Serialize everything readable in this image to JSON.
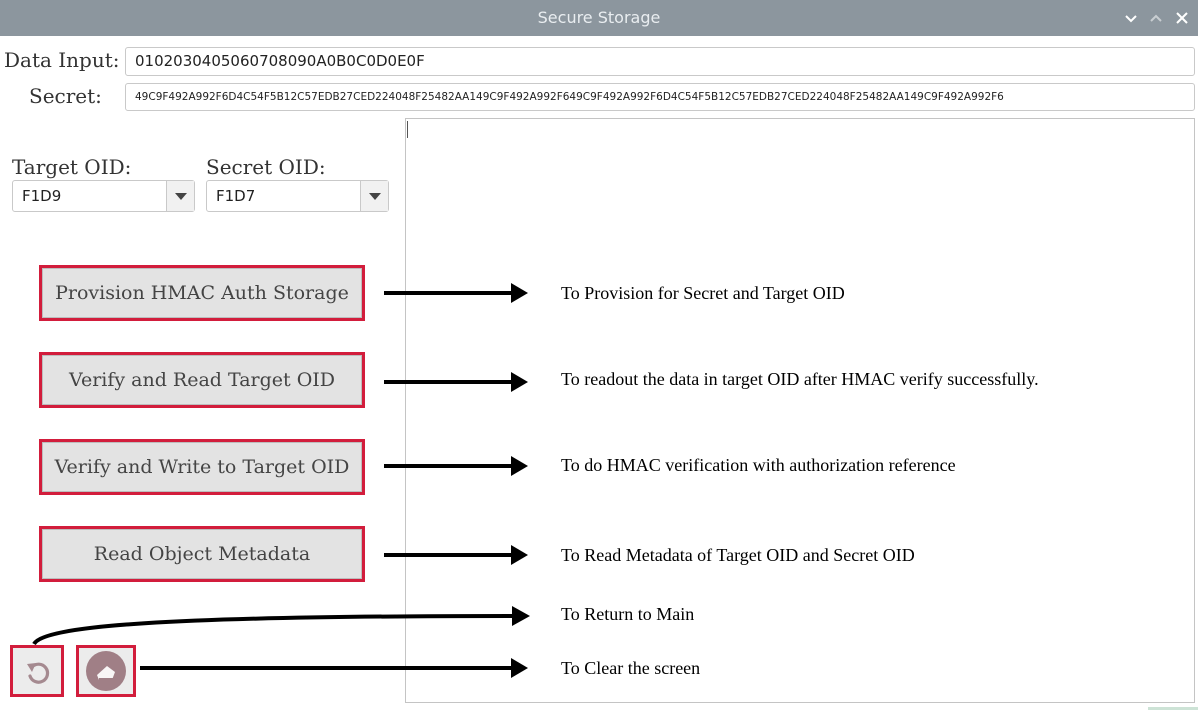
{
  "window": {
    "title": "Secure Storage",
    "controls": [
      "chevron-down-icon",
      "chevron-up-icon",
      "close-icon"
    ]
  },
  "inputs": {
    "data_label": "Data Input:",
    "data_value": "0102030405060708090A0B0C0D0E0F",
    "secret_label": "Secret:",
    "secret_value": "49C9F492A992F6D4C54F5B12C57EDB27CED224048F25482AA149C9F492A992F649C9F492A992F6D4C54F5B12C57EDB27CED224048F25482AA149C9F492A992F6"
  },
  "selectors": {
    "target_label": "Target OID:",
    "target_value": "F1D9",
    "secret_label": "Secret OID:",
    "secret_value": "F1D7"
  },
  "buttons": {
    "provision": "Provision HMAC Auth Storage",
    "verify_read": "Verify and Read Target OID",
    "verify_write": "Verify and Write to Target OID",
    "read_metadata": "Read Object Metadata"
  },
  "icon_buttons": {
    "back_icon": "back-icon",
    "clear_icon": "clear-screen-icon"
  },
  "annotations": {
    "provision": "To Provision for Secret and Target OID",
    "verify_read": "To readout the data in target OID after HMAC verify successfully.",
    "verify_write": "To do HMAC verification with authorization reference",
    "read_metadata": "To Read Metadata of Target OID and Secret OID",
    "back": "To Return to Main",
    "clear": "To Clear the screen"
  },
  "colors": {
    "titlebar": "#8c969e",
    "highlight_border": "#d21d3c",
    "button_bg": "#e3e3e3",
    "icon_fill": "#a07f86"
  },
  "output": {
    "text": ""
  }
}
